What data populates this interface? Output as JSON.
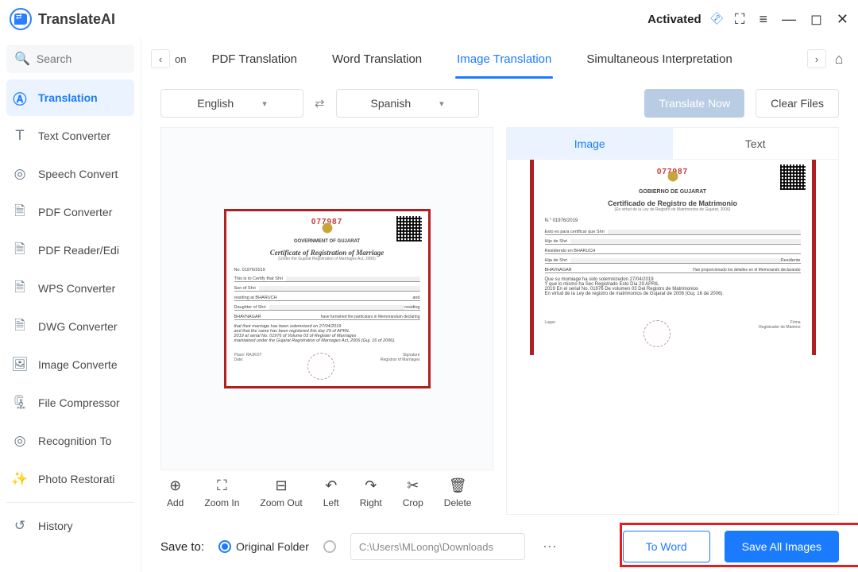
{
  "app": {
    "name": "TranslateAI",
    "status": "Activated"
  },
  "search": {
    "placeholder": "Search"
  },
  "sidebar": {
    "items": [
      {
        "label": "Translation"
      },
      {
        "label": "Text Converter"
      },
      {
        "label": "Speech Convert"
      },
      {
        "label": "PDF Converter"
      },
      {
        "label": "PDF Reader/Edi"
      },
      {
        "label": "WPS Converter"
      },
      {
        "label": "DWG Converter"
      },
      {
        "label": "Image Converte"
      },
      {
        "label": "File Compressor"
      },
      {
        "label": "Recognition To"
      },
      {
        "label": "Photo Restorati"
      }
    ],
    "history": "History"
  },
  "tabs": {
    "scroll_left_text": "on",
    "items": [
      {
        "label": "PDF Translation"
      },
      {
        "label": "Word Translation"
      },
      {
        "label": "Image Translation"
      },
      {
        "label": "Simultaneous Interpretation"
      }
    ]
  },
  "lang": {
    "from": "English",
    "to": "Spanish"
  },
  "actions": {
    "translate": "Translate Now",
    "clear": "Clear Files"
  },
  "result_tabs": {
    "image": "Image",
    "text": "Text"
  },
  "document_original": {
    "serial": "077987",
    "gov": "GOVERNMENT OF GUJARAT",
    "title": "Certificate of Registration of Marriage",
    "sub": "(Under the Gujarat Registration of Marriages Act, 2006)",
    "reg_no": "No. 01976/2019",
    "lines": {
      "certify": "This is to Certify that Shri",
      "son_of": "Son of Shri",
      "residing": "residing at   BHARUCH",
      "daughter": "Daughter of Shri",
      "place2": "BHAVNAGAR",
      "furnished": "have furnished the particulars in Memorandum declaring",
      "solemnized": "that their marriage has been solemnized on 27/04/2019",
      "registered": "and that the same has been registered this day 29 of APRIL",
      "serial_line": "2019 at serial No. 01976 of Volume 03 of Register of Marriages",
      "virtue": "maintained under the Gujarat Registration of Marriages Act, 2006 (Guj. 16 of 2006).",
      "place_label": "Place:",
      "place_value": "RAJKOT",
      "date_label": "Date:",
      "signature": "Signature",
      "registrar": "Registrar of Marriages"
    }
  },
  "document_translated": {
    "serial": "077987",
    "gov": "GOBIERNO DE GUJARAT",
    "title": "Certificado de Registro de Matrimonio",
    "sub": "(En virtud de la Ley de Registro de Matrimonios de Gujarat, 2006)",
    "reg_no": "N.° 01976/2019",
    "lines": {
      "certify": "Esto es para certificar que Shri",
      "son_of": "Hijo de Shri",
      "residing": "Residiendo en   BHARUCH",
      "daughter": "Hija de Shri",
      "place2": "BHAVNAGAR",
      "furnished": "Han proporcionado los detalles en el Memorando declarando",
      "solemnized": "Que su momiage ha sido solemnizedon 27/04/2019",
      "registered": "Y que lo mismo ha Sec Registrado Esto Día 29 APRIL",
      "serial_line": "2019 En el serial No. 01976 De volumen 03 Del Registro de Matrimonios",
      "virtue": "En virtud de la Ley de registro de matrimonios de Gujarat de 2006 (Guj. 16 de 2006).",
      "place_label": "Lugar:",
      "signature": "Firma",
      "registrar": "Registrador de Matrimo"
    }
  },
  "tools": {
    "add": "Add",
    "zoom_in": "Zoom In",
    "zoom_out": "Zoom Out",
    "left": "Left",
    "right": "Right",
    "crop": "Crop",
    "delete": "Delete"
  },
  "footer": {
    "save_to": "Save to:",
    "original_folder": "Original Folder",
    "path": "C:\\Users\\MLoong\\Downloads",
    "to_word": "To Word",
    "save_all": "Save All Images"
  }
}
